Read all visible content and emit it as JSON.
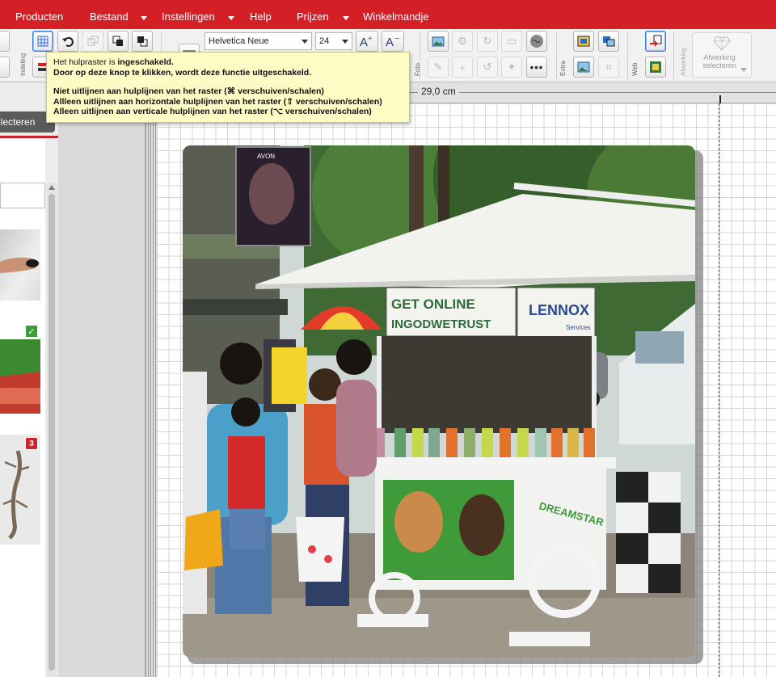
{
  "menu": {
    "items": [
      {
        "label": "Producten",
        "has_caret": false
      },
      {
        "label": "Bestand",
        "has_caret": true
      },
      {
        "label": "Instellingen",
        "has_caret": true
      },
      {
        "label": "Help",
        "has_caret": false
      },
      {
        "label": "Prijzen",
        "has_caret": true
      },
      {
        "label": "Winkelmandje",
        "has_caret": false
      }
    ]
  },
  "toolbar": {
    "group_labels": {
      "indeling": "Indeling",
      "foto": "Foto",
      "extra": "Extra",
      "web": "Web",
      "afwerking": "Afwerking"
    },
    "font_family": "Helvetica Neue",
    "font_size": "24",
    "afwerking_button": "Afwerking selecteren"
  },
  "tooltip": {
    "line1_prefix": "Het hulpraster is ",
    "line1_bold": "ingeschakeld.",
    "line2": "Door op deze knop te klikken, wordt deze functie uitgeschakeld.",
    "line3": "Niet uitlijnen aan hulplijnen van het raster (⌘ verschuiven/schalen)",
    "line4": "Allleen uitlijnen aan horizontale hulplijnen van het raster (⇧ verschuiven/schalen)",
    "line5": "Alleen uitlijnen aan verticale hulplijnen van het raster (⌥ verschuiven/schalen)"
  },
  "ruler": {
    "measurement": "29,0 cm"
  },
  "left_panel": {
    "select_tab": "electeren",
    "badges": {
      "used": "✓",
      "count": "3"
    }
  },
  "photo": {
    "signs": {
      "main_line1": "GET ONLINE",
      "main_line2": "INGODWETRUST",
      "lennox": "LENNOX",
      "lennox_sub": "Services",
      "cart_side": "DREAMSTAR"
    }
  },
  "colors": {
    "brand_red": "#d41f26",
    "tooltip_bg": "#fefbc5",
    "grid_line": "#d6d6d6"
  }
}
